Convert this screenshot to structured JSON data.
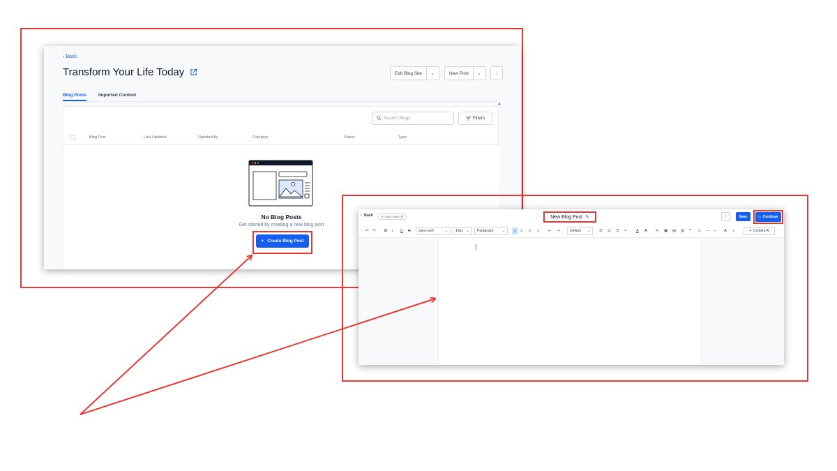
{
  "blog_list": {
    "back": "Back",
    "title": "Transform Your Life Today",
    "edit_blog_site": "Edit Blog Site",
    "new_post": "New Post",
    "tabs": [
      "Blog Posts",
      "Imported Content"
    ],
    "search_placeholder": "Search Blogs",
    "filters": "Filters",
    "columns": [
      "Blog Post",
      "Last Updated",
      "Updated By",
      "Category",
      "Status",
      "Type"
    ],
    "empty_title": "No Blog Posts",
    "empty_subtitle": "Get started by creating a new blog post",
    "create_button": "Create Blog Post"
  },
  "editor": {
    "back": "Back",
    "autosave": "Auto-save off",
    "title": "New Blog Post",
    "save": "Save",
    "continue": "Continue",
    "font_family": "sans-serif",
    "font_size": "16px",
    "block_type": "Paragraph",
    "line_height": "Default",
    "content_ai": "Content AI"
  },
  "colors": {
    "accent": "#155eef",
    "annotation_red": "#e53935"
  }
}
